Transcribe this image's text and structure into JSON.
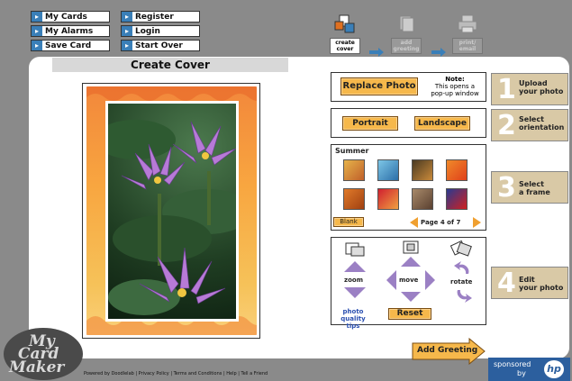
{
  "nav": {
    "my_cards": "My Cards",
    "register": "Register",
    "my_alarms": "My Alarms",
    "login": "Login",
    "save_card": "Save Card",
    "start_over": "Start Over"
  },
  "steps": {
    "create_cover_line1": "create",
    "create_cover_line2": "cover",
    "add_greeting_line1": "add",
    "add_greeting_line2": "greeting",
    "print_email_line1": "print/",
    "print_email_line2": "email"
  },
  "main": {
    "title": "Create Cover"
  },
  "upload": {
    "replace_photo": "Replace Photo",
    "note_title": "Note:",
    "note_line1": "This opens a",
    "note_line2": "pop-up window",
    "tab_number": "1",
    "tab_line1": "Upload",
    "tab_line2": "your photo"
  },
  "orientation": {
    "portrait": "Portrait",
    "landscape": "Landscape",
    "tab_number": "2",
    "tab_line1": "Select",
    "tab_line2": "orientation"
  },
  "frames": {
    "category": "Summer",
    "blank": "Blank",
    "page_info": "Page 4 of 7",
    "tab_number": "3",
    "tab_line1": "Select",
    "tab_line2": "a frame"
  },
  "edit": {
    "zoom": "zoom",
    "move": "move",
    "rotate": "rotate",
    "reset": "Reset",
    "photo_tips_line1": "photo",
    "photo_tips_line2": "quality tips",
    "tab_number": "4",
    "tab_line1": "Edit",
    "tab_line2": "your photo"
  },
  "add_greeting": "Add Greeting",
  "logo": {
    "line1": "My",
    "line2": "Card",
    "line3": "Maker"
  },
  "footer": "Powered by Doodlelab  |  Privacy Policy  |  Terms and Conditions  |  Help  |  Tell a Friend",
  "sponsor": {
    "line1": "sponsored",
    "line2": "by",
    "brand": "hp"
  },
  "colors": {
    "accent_orange": "#f6b84b",
    "tab_bg": "#d9c9a6",
    "nav_arrow": "#3a7fb8",
    "control_purple": "#9b80c4"
  }
}
